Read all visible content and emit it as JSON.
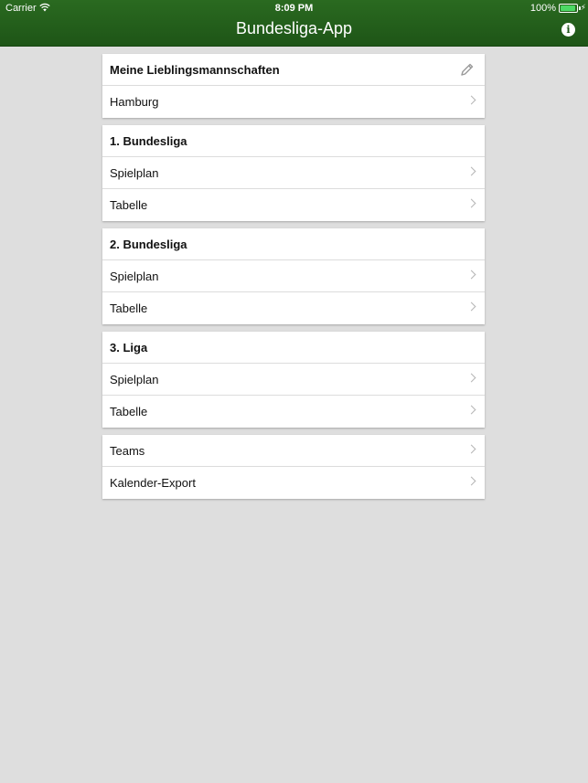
{
  "status_bar": {
    "carrier": "Carrier",
    "time": "8:09 PM",
    "battery": "100%"
  },
  "nav": {
    "title": "Bundesliga-App",
    "info_icon": "info-icon"
  },
  "favorites": {
    "header": "Meine Lieblingsmannschaften",
    "edit_icon": "pencil-icon",
    "items": [
      "Hamburg"
    ]
  },
  "bundesliga1": {
    "header": "1. Bundesliga",
    "items": [
      "Spielplan",
      "Tabelle"
    ]
  },
  "bundesliga2": {
    "header": "2. Bundesliga",
    "items": [
      "Spielplan",
      "Tabelle"
    ]
  },
  "liga3": {
    "header": "3. Liga",
    "items": [
      "Spielplan",
      "Tabelle"
    ]
  },
  "misc": {
    "items": [
      "Teams",
      "Kalender-Export"
    ]
  },
  "colors": {
    "nav_green": "#1e5517",
    "background": "#dedede",
    "battery": "#4cd964"
  }
}
